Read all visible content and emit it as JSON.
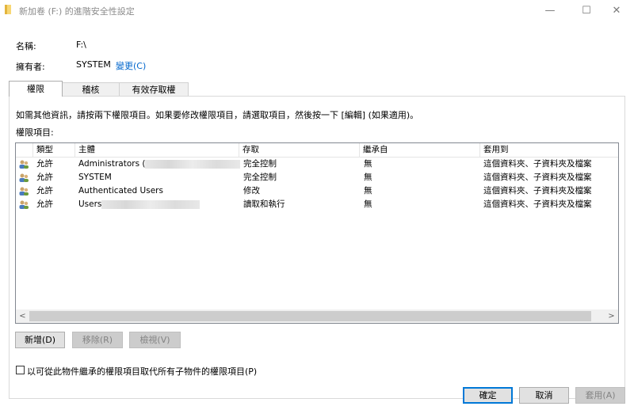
{
  "window": {
    "title": "新加卷 (F:) 的進階安全性設定",
    "minimize": "—",
    "maximize": "☐",
    "close": "✕"
  },
  "info": {
    "name_label": "名稱:",
    "name_value": "F:\\",
    "owner_label": "擁有者:",
    "owner_value": "SYSTEM",
    "change_link": "變更(C)"
  },
  "tabs": [
    {
      "label": "權限",
      "active": true
    },
    {
      "label": "稽核",
      "active": false
    },
    {
      "label": "有效存取權",
      "active": false
    }
  ],
  "panel": {
    "instruction": "如需其他資訊，請按兩下權限項目。如果要修改權限項目，請選取項目，然後按一下 [編輯] (如果適用)。",
    "entries_label": "權限項目:"
  },
  "table": {
    "columns": [
      "類型",
      "主體",
      "存取",
      "繼承自",
      "套用到"
    ],
    "rows": [
      {
        "type": "允許",
        "principal": "Administrators (",
        "access": "完全控制",
        "inherited": "無",
        "applies": "這個資料夾、子資料夾及檔案"
      },
      {
        "type": "允許",
        "principal": "SYSTEM",
        "access": "完全控制",
        "inherited": "無",
        "applies": "這個資料夾、子資料夾及檔案"
      },
      {
        "type": "允許",
        "principal": "Authenticated Users",
        "access": "修改",
        "inherited": "無",
        "applies": "這個資料夾、子資料夾及檔案"
      },
      {
        "type": "允許",
        "principal": "Users",
        "access": "讀取和執行",
        "inherited": "無",
        "applies": "這個資料夾、子資料夾及檔案"
      }
    ]
  },
  "scroll": {
    "left": "<",
    "right": ">"
  },
  "buttons": {
    "add": "新增(D)",
    "remove": "移除(R)",
    "view": "檢視(V)"
  },
  "replace_checkbox_label": "以可從此物件繼承的權限項目取代所有子物件的權限項目(P)",
  "footer": {
    "ok": "確定",
    "cancel": "取消",
    "apply": "套用(A)"
  },
  "colors": {
    "link": "#0066cc",
    "default_button_border": "#0078d7"
  }
}
